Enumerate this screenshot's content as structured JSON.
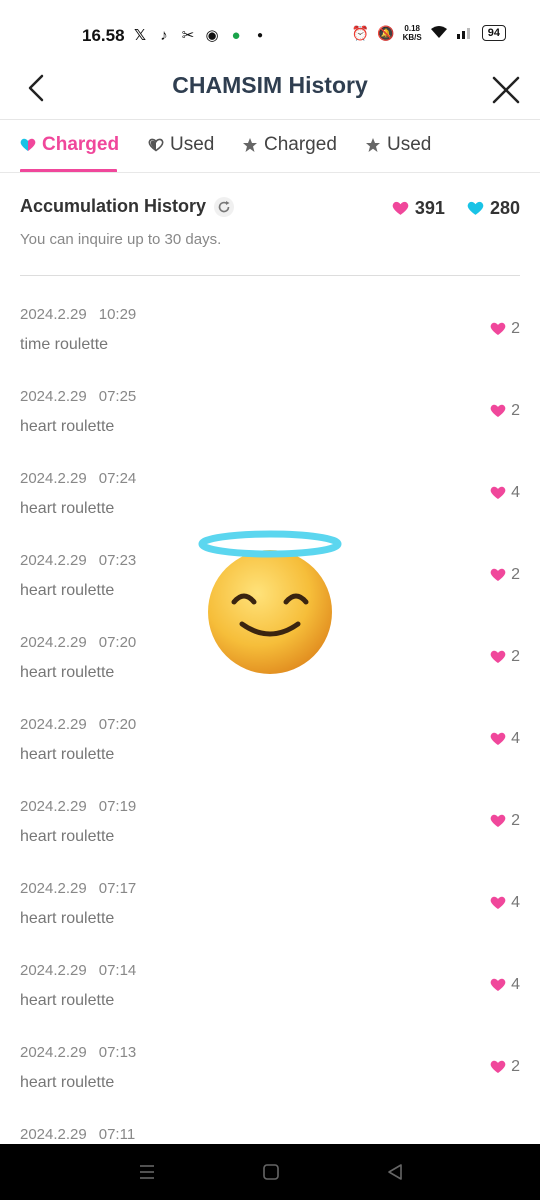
{
  "status": {
    "time": "16.58",
    "netspeed_value": "0.18",
    "netspeed_unit": "KB/S",
    "battery": "94"
  },
  "header": {
    "title": "CHAMSIM History"
  },
  "tabs": [
    {
      "label": "Charged",
      "icon": "heart-icon",
      "active": true
    },
    {
      "label": "Used",
      "icon": "heart-outline-icon",
      "active": false
    },
    {
      "label": "Charged",
      "icon": "star-icon",
      "active": false
    },
    {
      "label": "Used",
      "icon": "star-icon",
      "active": false
    }
  ],
  "summary": {
    "title": "Accumulation History",
    "note": "You can inquire up to 30 days.",
    "pink_count": "391",
    "cyan_count": "280"
  },
  "colors": {
    "accent_pink": "#f0479b",
    "cyan": "#19c3e6",
    "title": "#2f3e50"
  },
  "history": [
    {
      "date": "2024.2.29",
      "time": "10:29",
      "desc": "time roulette",
      "amount": "2"
    },
    {
      "date": "2024.2.29",
      "time": "07:25",
      "desc": "heart roulette",
      "amount": "2"
    },
    {
      "date": "2024.2.29",
      "time": "07:24",
      "desc": "heart roulette",
      "amount": "4"
    },
    {
      "date": "2024.2.29",
      "time": "07:23",
      "desc": "heart roulette",
      "amount": "2"
    },
    {
      "date": "2024.2.29",
      "time": "07:20",
      "desc": "heart roulette",
      "amount": "2"
    },
    {
      "date": "2024.2.29",
      "time": "07:20",
      "desc": "heart roulette",
      "amount": "4"
    },
    {
      "date": "2024.2.29",
      "time": "07:19",
      "desc": "heart roulette",
      "amount": "2"
    },
    {
      "date": "2024.2.29",
      "time": "07:17",
      "desc": "heart roulette",
      "amount": "4"
    },
    {
      "date": "2024.2.29",
      "time": "07:14",
      "desc": "heart roulette",
      "amount": "4"
    },
    {
      "date": "2024.2.29",
      "time": "07:13",
      "desc": "heart roulette",
      "amount": "2"
    },
    {
      "date": "2024.2.29",
      "time": "07:11",
      "desc": "",
      "amount": ""
    }
  ]
}
